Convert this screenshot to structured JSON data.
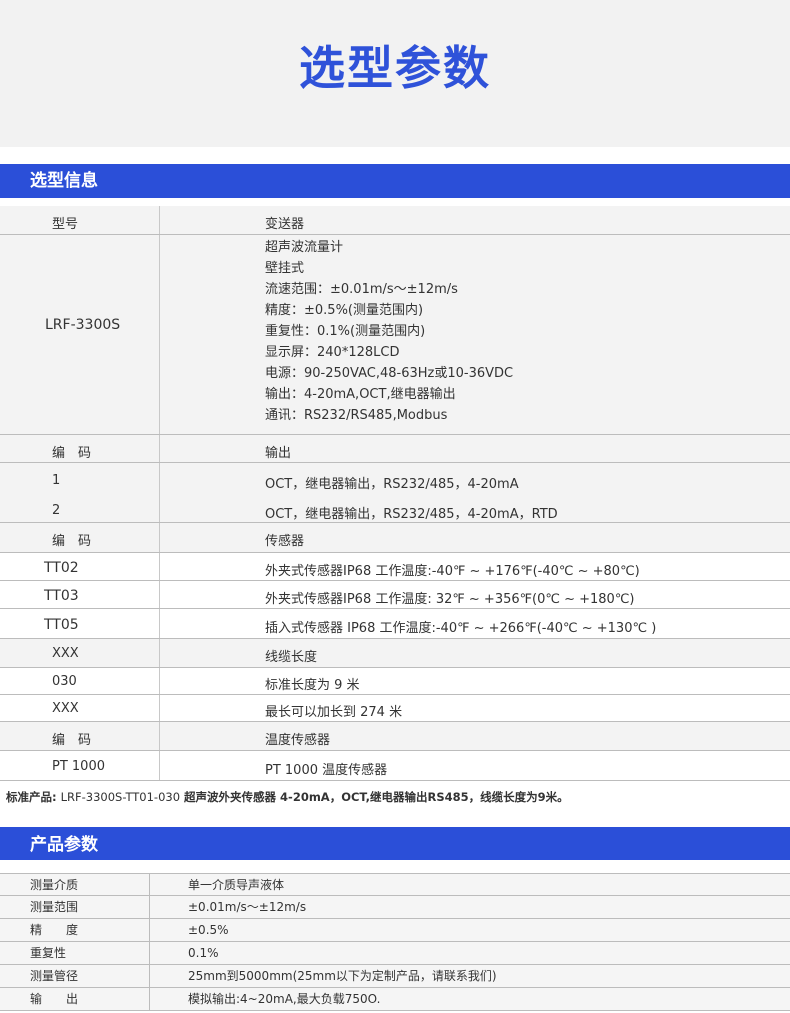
{
  "hero": {
    "title": "选型参数"
  },
  "section1": {
    "title": "选型信息"
  },
  "model_header": {
    "col1": "型号",
    "col2": "变送器"
  },
  "model": {
    "name": "LRF-3300S",
    "specs": [
      "超声波流量计",
      "壁挂式",
      "流速范围：±0.01m/s～±12m/s",
      "精度：±0.5%(测量范围内)",
      "重复性：0.1%(测量范围内)",
      "显示屏：240*128LCD",
      "电源：90-250VAC,48-63Hz或10-36VDC",
      "输出：4-20mA,OCT,继电器输出",
      "通讯：RS232/RS485,Modbus"
    ]
  },
  "output_header": {
    "col1": "编　码",
    "col2": "输出"
  },
  "outputs": [
    {
      "code": "1",
      "desc": "OCT，继电器输出，RS232/485，4-20mA"
    },
    {
      "code": "2",
      "desc": "OCT，继电器输出，RS232/485，4-20mA，RTD"
    }
  ],
  "sensor_header": {
    "col1": "编　码",
    "col2": "传感器"
  },
  "sensors": [
    {
      "code": "TT02",
      "desc": "外夹式传感器IP68 工作温度:-40℉ ~ +176℉(-40℃ ~ +80℃)"
    },
    {
      "code": "TT03",
      "desc": "外夹式传感器IP68 工作温度: 32℉ ~ +356℉(0℃ ~ +180℃)"
    },
    {
      "code": "TT05",
      "desc": "插入式传感器 IP68 工作温度:-40℉ ~ +266℉(-40℃ ~ +130℃ )"
    }
  ],
  "cable_header": {
    "col1": "XXX",
    "col2": "线缆长度"
  },
  "cables": [
    {
      "code": "030",
      "desc": "标准长度为 9 米"
    },
    {
      "code": "XXX",
      "desc": "最长可以加长到 274 米"
    }
  ],
  "temp_header": {
    "col1": "编　码",
    "col2": "温度传感器"
  },
  "temps": [
    {
      "code": "PT 1000",
      "desc": "PT 1000 温度传感器"
    }
  ],
  "std_note": {
    "label": "标准产品:",
    "model": "LRF-3300S-TT01-030",
    "text": "超声波外夹传感器 4-20mA，OCT,继电器输出RS485，线缆长度为9米。"
  },
  "section2": {
    "title": "产品参数"
  },
  "params": [
    {
      "key": "测量介质",
      "value": "单一介质导声液体"
    },
    {
      "key": "测量范围",
      "value": "±0.01m/s～±12m/s"
    },
    {
      "key": "精　　度",
      "value": "±0.5%"
    },
    {
      "key": "重复性",
      "value": "0.1%"
    },
    {
      "key": "测量管径",
      "value": "25mm到5000mm(25mm以下为定制产品，请联系我们)"
    },
    {
      "key": "输　　出",
      "value": "模拟输出:4~20mA,最大负载750O."
    }
  ]
}
